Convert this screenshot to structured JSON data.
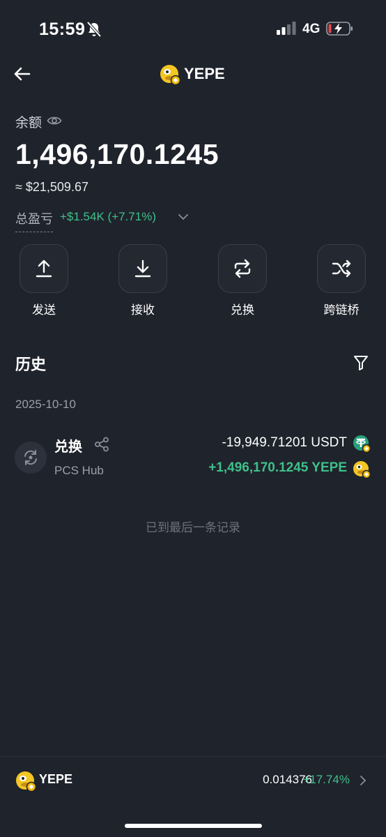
{
  "status_bar": {
    "time": "15:59",
    "network": "4G"
  },
  "header": {
    "title": "YEPE"
  },
  "balance": {
    "label": "余额",
    "amount": "1,496,170.1245",
    "usd": "≈ $21,509.67",
    "pnl_label": "总盈亏",
    "pnl_value": "+$1.54K (+7.71%)"
  },
  "actions": [
    {
      "label": "发送",
      "icon": "upload-icon"
    },
    {
      "label": "接收",
      "icon": "download-icon"
    },
    {
      "label": "兑换",
      "icon": "swap-icon"
    },
    {
      "label": "跨链桥",
      "icon": "shuffle-icon"
    }
  ],
  "history": {
    "title": "历史",
    "date": "2025-10-10",
    "transactions": [
      {
        "type": "兑换",
        "source": "PCS Hub",
        "out_amount": "-19,949.71201 USDT",
        "in_amount": "+1,496,170.1245 YEPE"
      }
    ],
    "end_note": "已到最后一条记录"
  },
  "bottom_bar": {
    "name": "YEPE",
    "price": "0.014376",
    "change": "+17.74%"
  },
  "colors": {
    "background": "#1f232c",
    "positive": "#3fc08a",
    "muted": "#9aa0aa"
  }
}
